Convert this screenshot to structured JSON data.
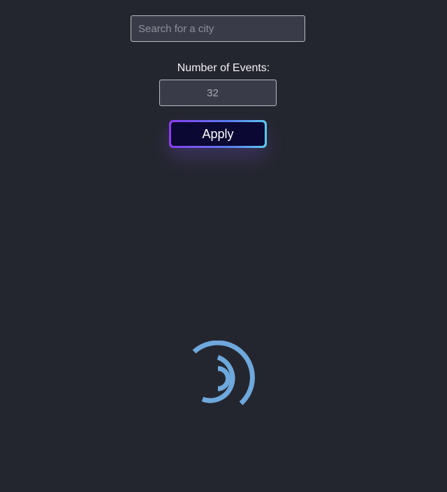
{
  "search": {
    "placeholder": "Search for a city",
    "value": ""
  },
  "events": {
    "label": "Number of Events:",
    "value": "32"
  },
  "apply": {
    "label": "Apply"
  },
  "loader": {
    "icon": "loading-spinner-icon",
    "color": "#6ea8dc"
  },
  "colors": {
    "background": "#24262f",
    "input_background": "#393c48",
    "button_background": "#0b0833",
    "gradient_start": "#8a3cf0",
    "gradient_end": "#5cc8f0"
  }
}
